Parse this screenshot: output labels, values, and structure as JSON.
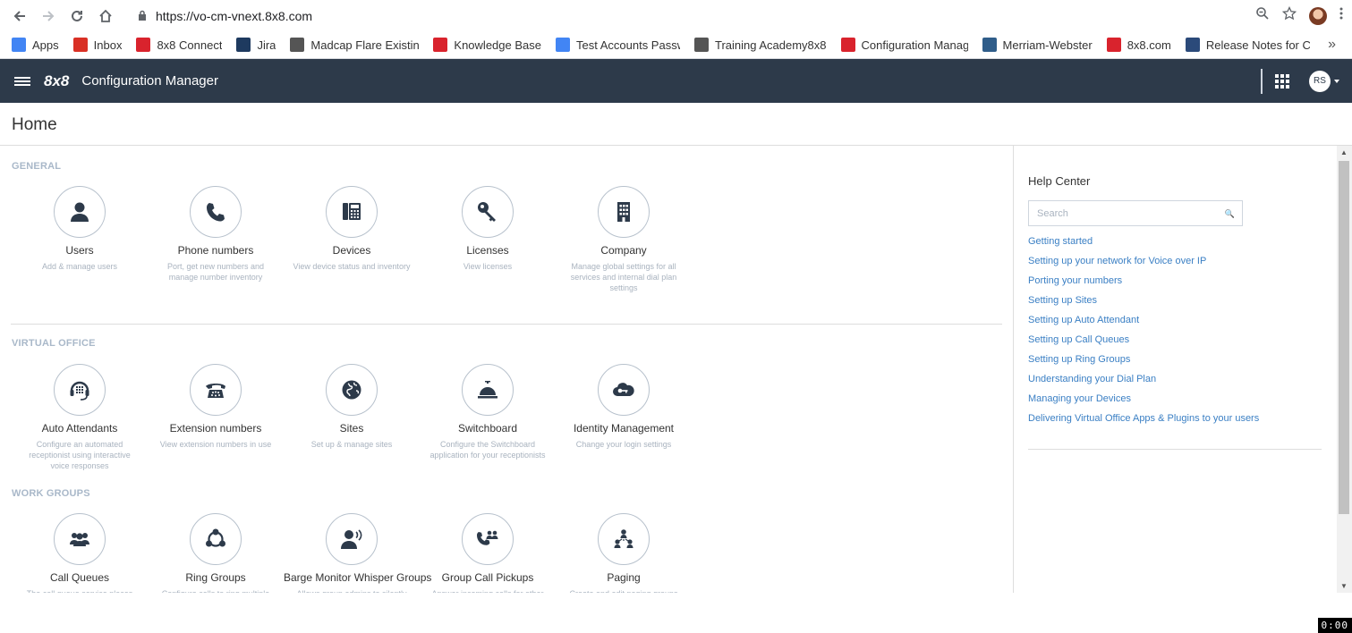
{
  "browser": {
    "url": "https://vo-cm-vnext.8x8.com",
    "bookmarks": [
      {
        "label": "Apps",
        "icon": "apps-icon",
        "color": "#4285f4"
      },
      {
        "label": "Inbox",
        "icon": "gmail-icon",
        "color": "#d93025"
      },
      {
        "label": "8x8 Connect",
        "icon": "8x8-icon",
        "color": "#d9232d"
      },
      {
        "label": "Jira",
        "icon": "jira-icon",
        "color": "#1e3a5f"
      },
      {
        "label": "Madcap Flare Existinc",
        "icon": "madcap-icon",
        "color": "#555"
      },
      {
        "label": "Knowledge Base",
        "icon": "8x8-icon",
        "color": "#d9232d"
      },
      {
        "label": "Test Accounts Passwc",
        "icon": "google-icon",
        "color": "#4285f4"
      },
      {
        "label": "Training Academy8x8",
        "icon": "page-icon",
        "color": "#555"
      },
      {
        "label": "Configuration Manag",
        "icon": "config-icon",
        "color": "#d9232d"
      },
      {
        "label": "Merriam-Webster",
        "icon": "mw-icon",
        "color": "#2f5d8a"
      },
      {
        "label": "8x8.com",
        "icon": "8x8-icon",
        "color": "#d9232d"
      },
      {
        "label": "Release Notes for Ca",
        "icon": "release-icon",
        "color": "#2b4a7a"
      }
    ]
  },
  "app": {
    "logo": "8x8",
    "title": "Configuration Manager",
    "user_initials": "RS",
    "accent": "#2d3a4a"
  },
  "page": {
    "title": "Home"
  },
  "sections": [
    {
      "title": "GENERAL",
      "tiles": [
        {
          "label": "Users",
          "desc": "Add & manage users",
          "icon": "user-icon"
        },
        {
          "label": "Phone numbers",
          "desc": "Port, get new numbers and manage number inventory",
          "icon": "phone-icon"
        },
        {
          "label": "Devices",
          "desc": "View device status and inventory",
          "icon": "desk-phone-icon"
        },
        {
          "label": "Licenses",
          "desc": "View licenses",
          "icon": "key-icon"
        },
        {
          "label": "Company",
          "desc": "Manage global settings for all services and internal dial plan settings",
          "icon": "building-icon"
        }
      ]
    },
    {
      "title": "VIRTUAL OFFICE",
      "tiles": [
        {
          "label": "Auto Attendants",
          "desc": "Configure an automated receptionist using interactive voice responses",
          "icon": "headset-icon"
        },
        {
          "label": "Extension numbers",
          "desc": "View extension numbers in use",
          "icon": "rotary-phone-icon"
        },
        {
          "label": "Sites",
          "desc": "Set up & manage sites",
          "icon": "globe-icon"
        },
        {
          "label": "Switchboard",
          "desc": "Configure the Switchboard application for your receptionists",
          "icon": "bell-icon"
        },
        {
          "label": "Identity Management",
          "desc": "Change your login settings",
          "icon": "cloud-key-icon"
        }
      ]
    },
    {
      "title": "WORK GROUPS",
      "tiles": [
        {
          "label": "Call Queues",
          "desc": "The call queue service places your",
          "icon": "group-icon"
        },
        {
          "label": "Ring Groups",
          "desc": "Configure calls to ring multiple",
          "icon": "ring-group-icon"
        },
        {
          "label": "Barge Monitor Whisper Groups",
          "desc": "Allows group admins to silently",
          "icon": "whisper-icon"
        },
        {
          "label": "Group Call Pickups",
          "desc": "Answer incoming calls for other",
          "icon": "group-pickup-icon"
        },
        {
          "label": "Paging",
          "desc": "Create and edit paging groups",
          "icon": "paging-icon"
        }
      ]
    }
  ],
  "help": {
    "title": "Help Center",
    "search_placeholder": "Search",
    "links": [
      "Getting started",
      "Setting up your network for Voice over IP",
      "Porting your numbers",
      "Setting up Sites",
      "Setting up Auto Attendant",
      "Setting up Call Queues",
      "Setting up Ring Groups",
      "Understanding your Dial Plan",
      "Managing your Devices",
      "Delivering Virtual Office Apps & Plugins to your users"
    ]
  },
  "recorder": {
    "time": "0:00"
  }
}
